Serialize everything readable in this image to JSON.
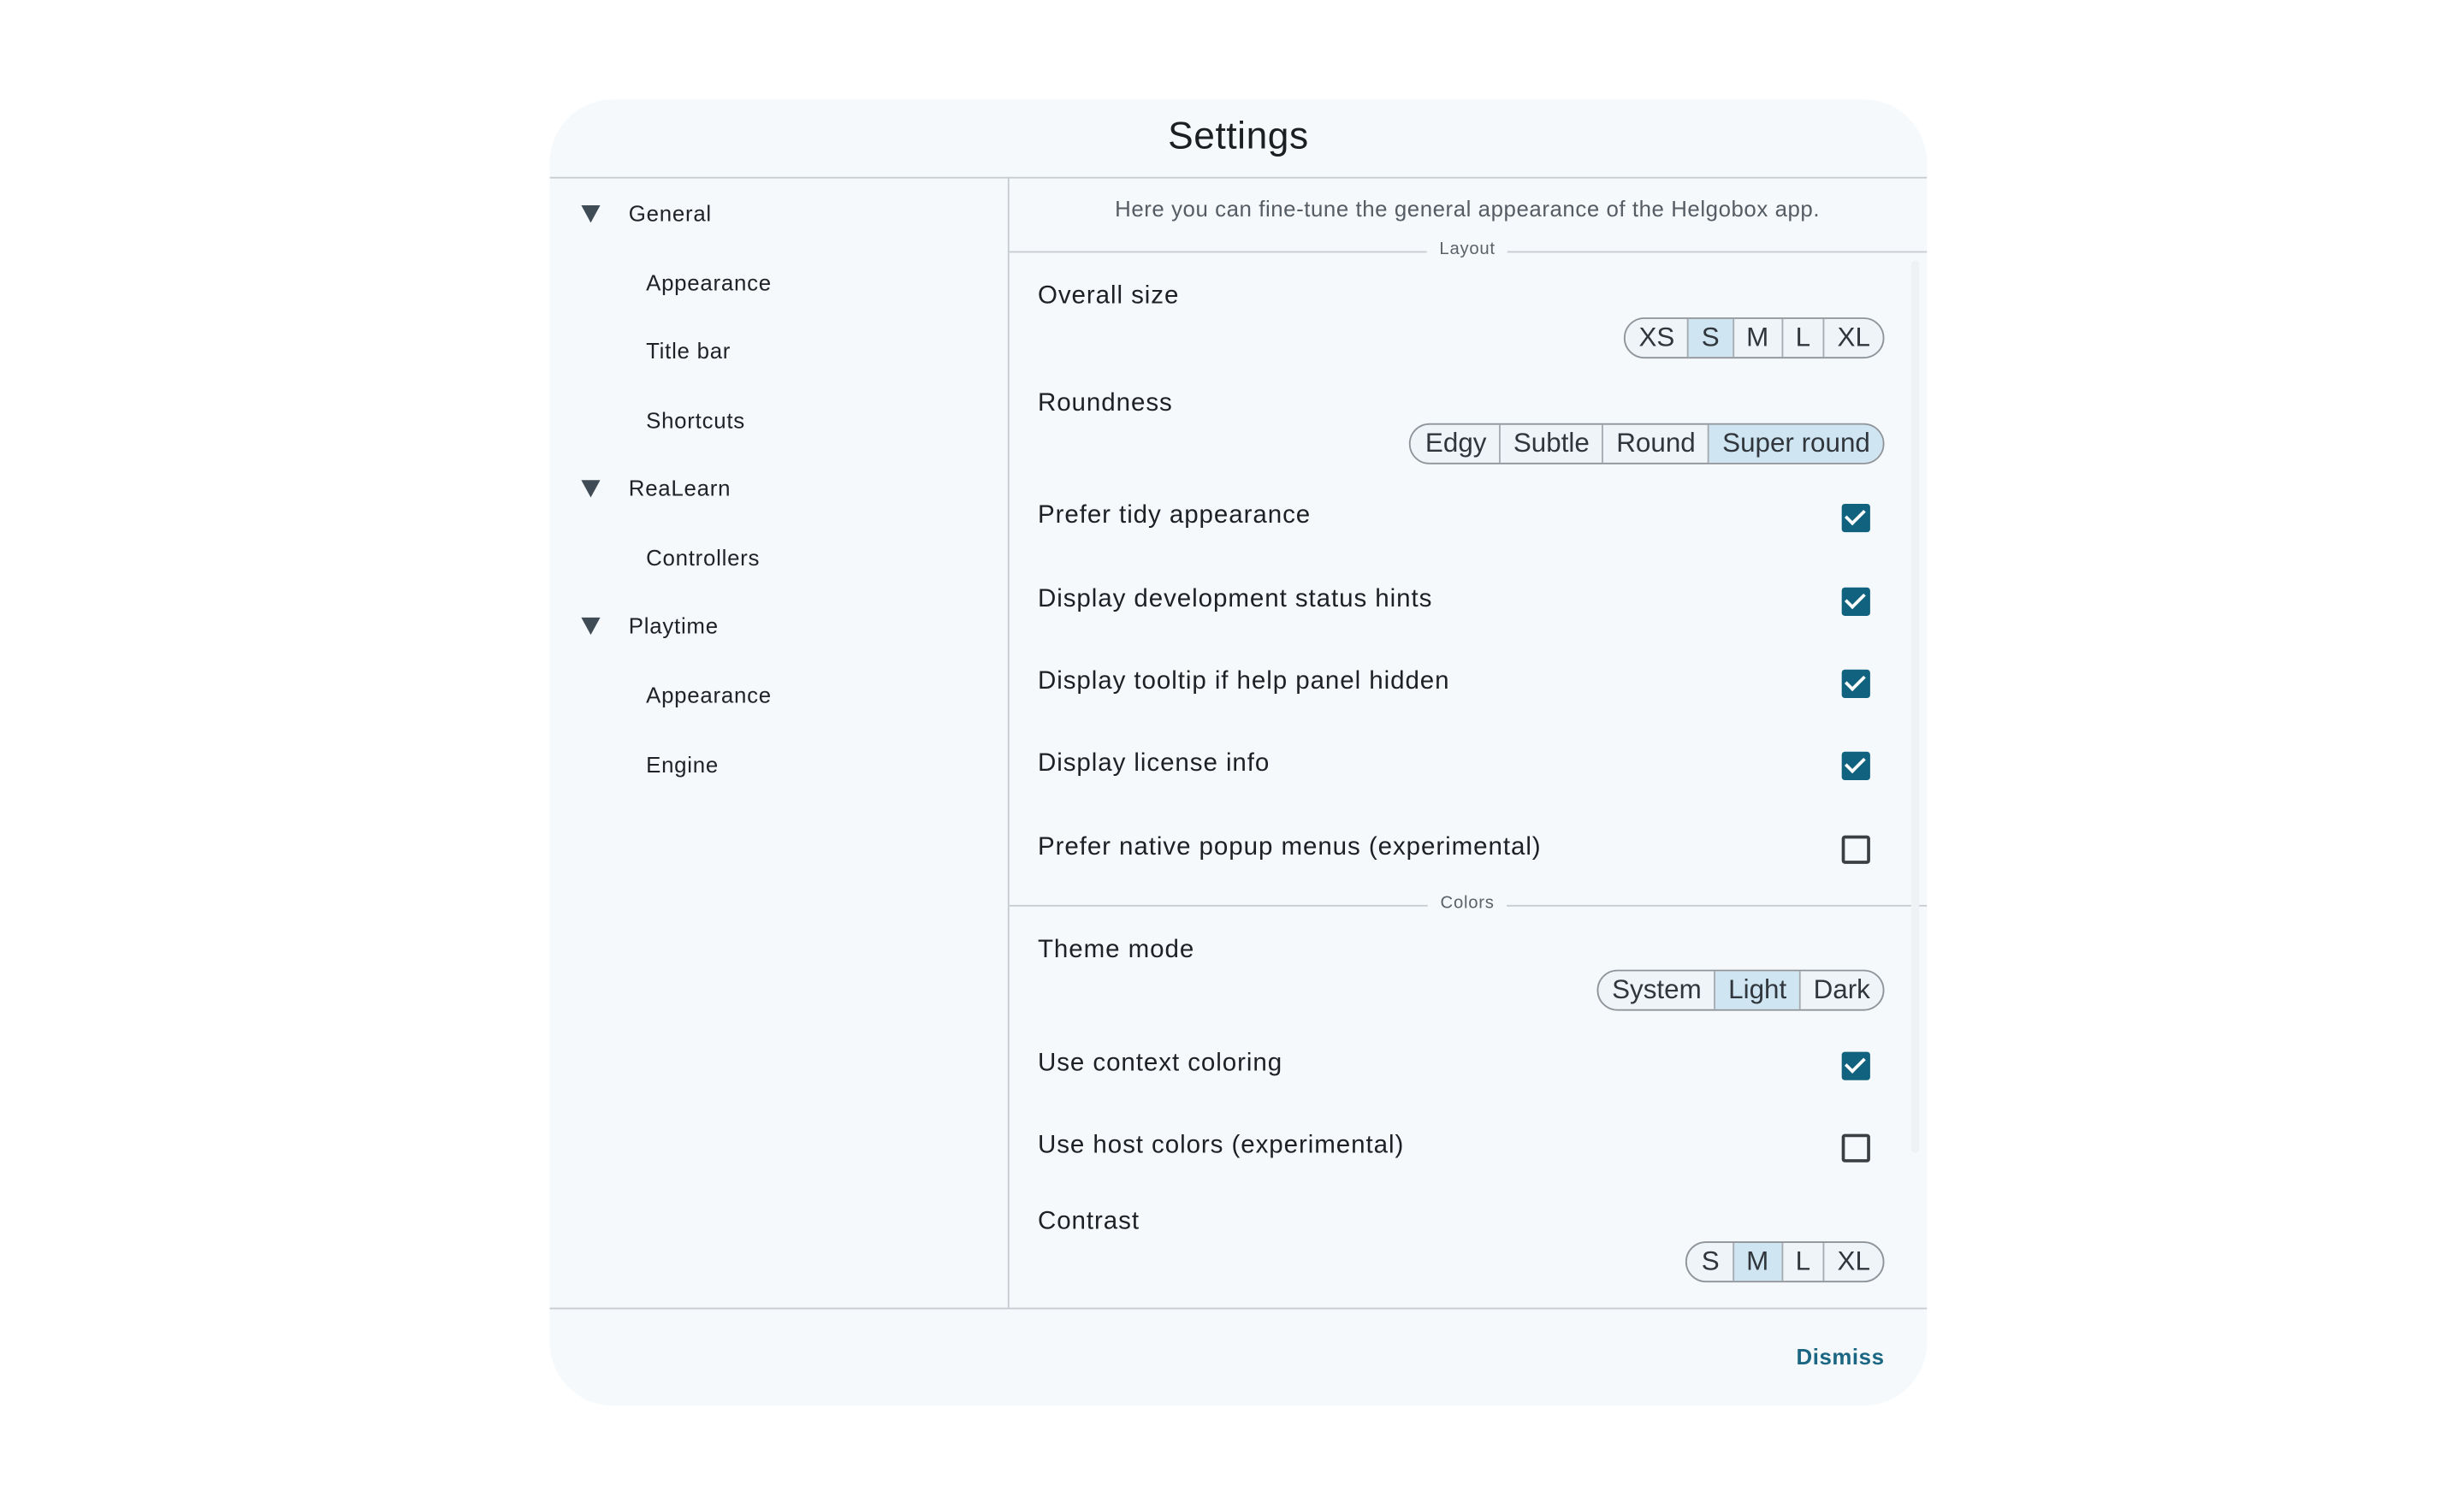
{
  "dialog": {
    "title": "Settings",
    "dismiss_label": "Dismiss"
  },
  "sidebar": {
    "groups": [
      {
        "label": "General",
        "expanded": true,
        "items": [
          "Appearance",
          "Title bar",
          "Shortcuts"
        ]
      },
      {
        "label": "ReaLearn",
        "expanded": true,
        "items": [
          "Controllers"
        ]
      },
      {
        "label": "Playtime",
        "expanded": true,
        "items": [
          "Appearance",
          "Engine"
        ]
      }
    ]
  },
  "main": {
    "description": "Here you can fine-tune the general appearance of the Helgobox app.",
    "layout_section": "Layout",
    "colors_section": "Colors",
    "overall_size": {
      "label": "Overall size",
      "options": [
        "XS",
        "S",
        "M",
        "L",
        "XL"
      ],
      "selected": "S"
    },
    "roundness": {
      "label": "Roundness",
      "options": [
        "Edgy",
        "Subtle",
        "Round",
        "Super round"
      ],
      "selected": "Super round"
    },
    "checks1": [
      {
        "label": "Prefer tidy appearance",
        "checked": true
      },
      {
        "label": "Display development status hints",
        "checked": true
      },
      {
        "label": "Display tooltip if help panel hidden",
        "checked": true
      },
      {
        "label": "Display license info",
        "checked": true
      },
      {
        "label": "Prefer native popup menus (experimental)",
        "checked": false
      }
    ],
    "theme_mode": {
      "label": "Theme mode",
      "options": [
        "System",
        "Light",
        "Dark"
      ],
      "selected": "Light"
    },
    "checks2": [
      {
        "label": "Use context coloring",
        "checked": true
      },
      {
        "label": "Use host colors (experimental)",
        "checked": false
      }
    ],
    "contrast": {
      "label": "Contrast",
      "options": [
        "S",
        "M",
        "L",
        "XL"
      ],
      "selected": "M"
    }
  },
  "colors": {
    "accent": "#11627e",
    "selected_segment": "#d0e5f2",
    "background": "#f5f9fc"
  }
}
